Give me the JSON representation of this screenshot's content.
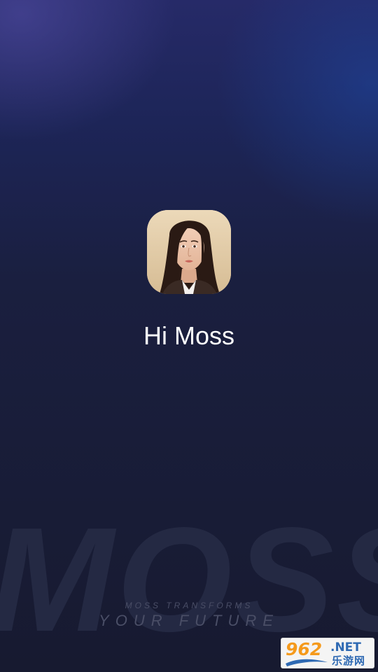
{
  "app": {
    "greeting": "Hi Moss",
    "background_word": "MOSS",
    "tagline_small": "MOSS TRANSFORMS",
    "tagline_large": "YOUR FUTURE"
  },
  "avatar": {
    "icon": "avatar-portrait-icon"
  },
  "watermark": {
    "number": "962",
    "domain": ".NET",
    "chinese": "乐游网"
  },
  "colors": {
    "background_top": "#262a68",
    "background_bottom": "#171a30",
    "greeting_text": "#ffffff",
    "tagline_text": "#4a4e66",
    "watermark_orange": "#f59a1c",
    "watermark_blue": "#2e69b3"
  }
}
